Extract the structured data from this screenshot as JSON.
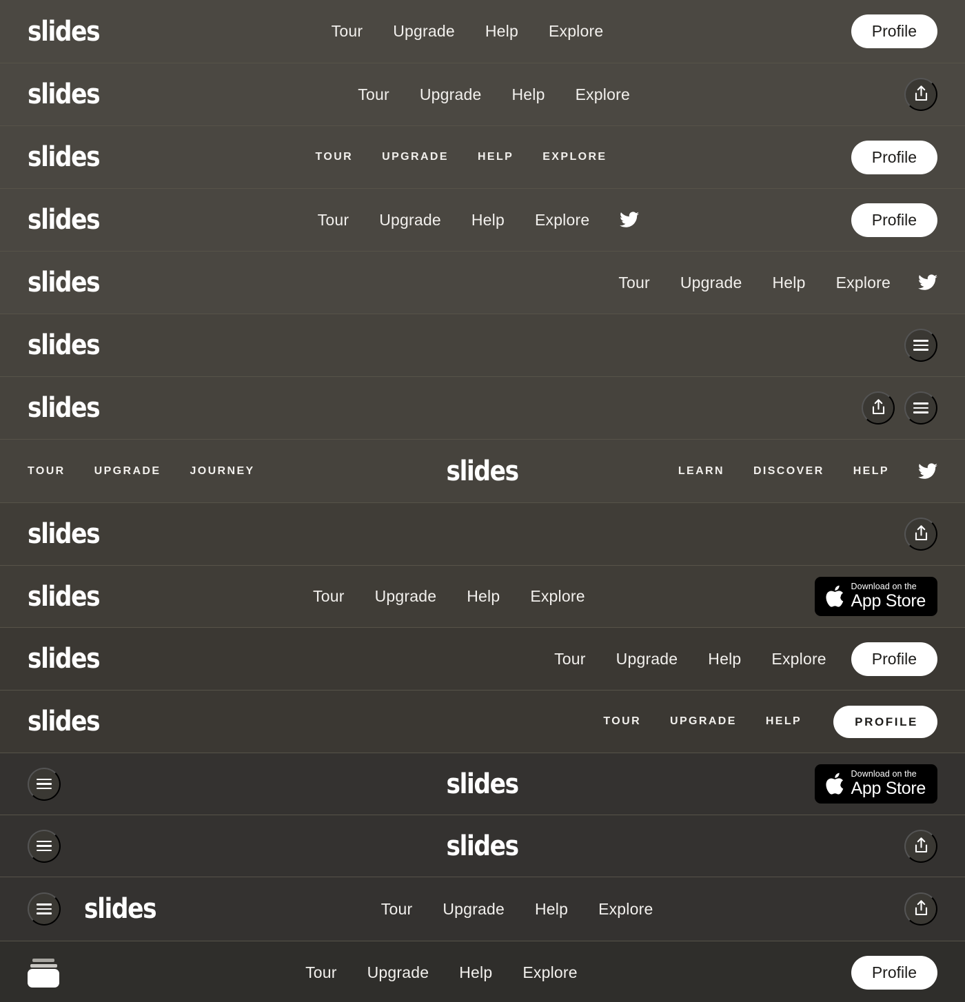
{
  "page": {
    "title": "slides — navigation bar variants",
    "background_color": "#4a4741",
    "divider_color": "#575349",
    "text_color": "#f2f0ed",
    "accent_white": "#ffffff",
    "badge_black": "#000000"
  },
  "brand": {
    "logo": "slides"
  },
  "labels": {
    "tour": "Tour",
    "upgrade": "Upgrade",
    "help": "Help",
    "explore": "Explore",
    "profile": "Profile",
    "tour_caps": "TOUR",
    "upgrade_caps": "UPGRADE",
    "help_caps": "HELP",
    "explore_caps": "EXPLORE",
    "journey_caps": "JOURNEY",
    "learn_caps": "LEARN",
    "discover_caps": "DISCOVER",
    "profile_caps": "PROFILE"
  },
  "appstore": {
    "eyebrow": "Download on the",
    "name": "App Store"
  },
  "icons": {
    "share": "share-icon",
    "menu": "hamburger-menu-icon",
    "twitter": "twitter-bird-icon",
    "apple": "apple-logo-icon",
    "cards": "stacked-cards-icon"
  },
  "rows": [
    {
      "id": 1,
      "layout": "logo-left / nav-center / profile-right",
      "tone": "tone-a",
      "nav_case": "sentence",
      "nav": [
        "Tour",
        "Upgrade",
        "Help",
        "Explore"
      ],
      "right": "profile-pill"
    },
    {
      "id": 2,
      "layout": "logo-left / nav-center / share-right",
      "tone": "tone-a",
      "nav_case": "sentence",
      "nav": [
        "Tour",
        "Upgrade",
        "Help",
        "Explore"
      ],
      "right": "share-circle"
    },
    {
      "id": 3,
      "layout": "logo-left / nav-center-caps / profile-right",
      "tone": "tone-b",
      "nav_case": "uppercase",
      "nav": [
        "TOUR",
        "UPGRADE",
        "HELP",
        "EXPLORE"
      ],
      "right": "profile-pill"
    },
    {
      "id": 4,
      "layout": "logo-left / nav-center + twitter / profile-right",
      "tone": "tone-b",
      "nav_case": "sentence",
      "nav": [
        "Tour",
        "Upgrade",
        "Help",
        "Explore"
      ],
      "social": "twitter",
      "right": "profile-pill"
    },
    {
      "id": 5,
      "layout": "logo-left / nav-right + twitter",
      "tone": "tone-b",
      "nav_case": "sentence",
      "nav": [
        "Tour",
        "Upgrade",
        "Help",
        "Explore"
      ],
      "social": "twitter"
    },
    {
      "id": 6,
      "layout": "logo-left / menu-right",
      "tone": "tone-c",
      "right": "menu-circle"
    },
    {
      "id": 7,
      "layout": "logo-left / share + menu right",
      "tone": "tone-c",
      "right": "share-circle,menu-circle"
    },
    {
      "id": 8,
      "layout": "split nav with centered logo",
      "tone": "tone-c",
      "nav_case": "uppercase",
      "nav_left": [
        "TOUR",
        "UPGRADE",
        "JOURNEY"
      ],
      "nav_right": [
        "LEARN",
        "DISCOVER",
        "HELP"
      ],
      "social": "twitter"
    },
    {
      "id": 9,
      "layout": "logo-left / share-right",
      "tone": "tone-d",
      "right": "share-circle"
    },
    {
      "id": 10,
      "layout": "logo-left / nav-center / app-store-right",
      "tone": "tone-d",
      "nav_case": "sentence",
      "nav": [
        "Tour",
        "Upgrade",
        "Help",
        "Explore"
      ],
      "right": "app-store-badge"
    },
    {
      "id": 11,
      "layout": "logo-left / nav-right / profile",
      "tone": "tone-e",
      "nav_case": "sentence",
      "nav": [
        "Tour",
        "Upgrade",
        "Help",
        "Explore"
      ],
      "right": "profile-pill"
    },
    {
      "id": 12,
      "layout": "logo-left / nav-right-caps / profile-caps",
      "tone": "tone-e",
      "nav_case": "uppercase",
      "nav": [
        "TOUR",
        "UPGRADE",
        "HELP"
      ],
      "right": "profile-pill-caps"
    },
    {
      "id": 13,
      "layout": "menu-left / logo-center / app-store-right",
      "tone": "tone-f",
      "right": "app-store-badge"
    },
    {
      "id": 14,
      "layout": "menu-left / logo-center / share-right",
      "tone": "tone-f",
      "right": "share-circle"
    },
    {
      "id": 15,
      "layout": "menu + logo left / nav-center / share-right",
      "tone": "tone-f",
      "nav_case": "sentence",
      "nav": [
        "Tour",
        "Upgrade",
        "Help",
        "Explore"
      ],
      "right": "share-circle"
    },
    {
      "id": 16,
      "layout": "cards-icon left / nav-center / profile-right",
      "tone": "tone-g",
      "nav_case": "sentence",
      "nav": [
        "Tour",
        "Upgrade",
        "Help",
        "Explore"
      ],
      "right": "profile-pill"
    }
  ]
}
